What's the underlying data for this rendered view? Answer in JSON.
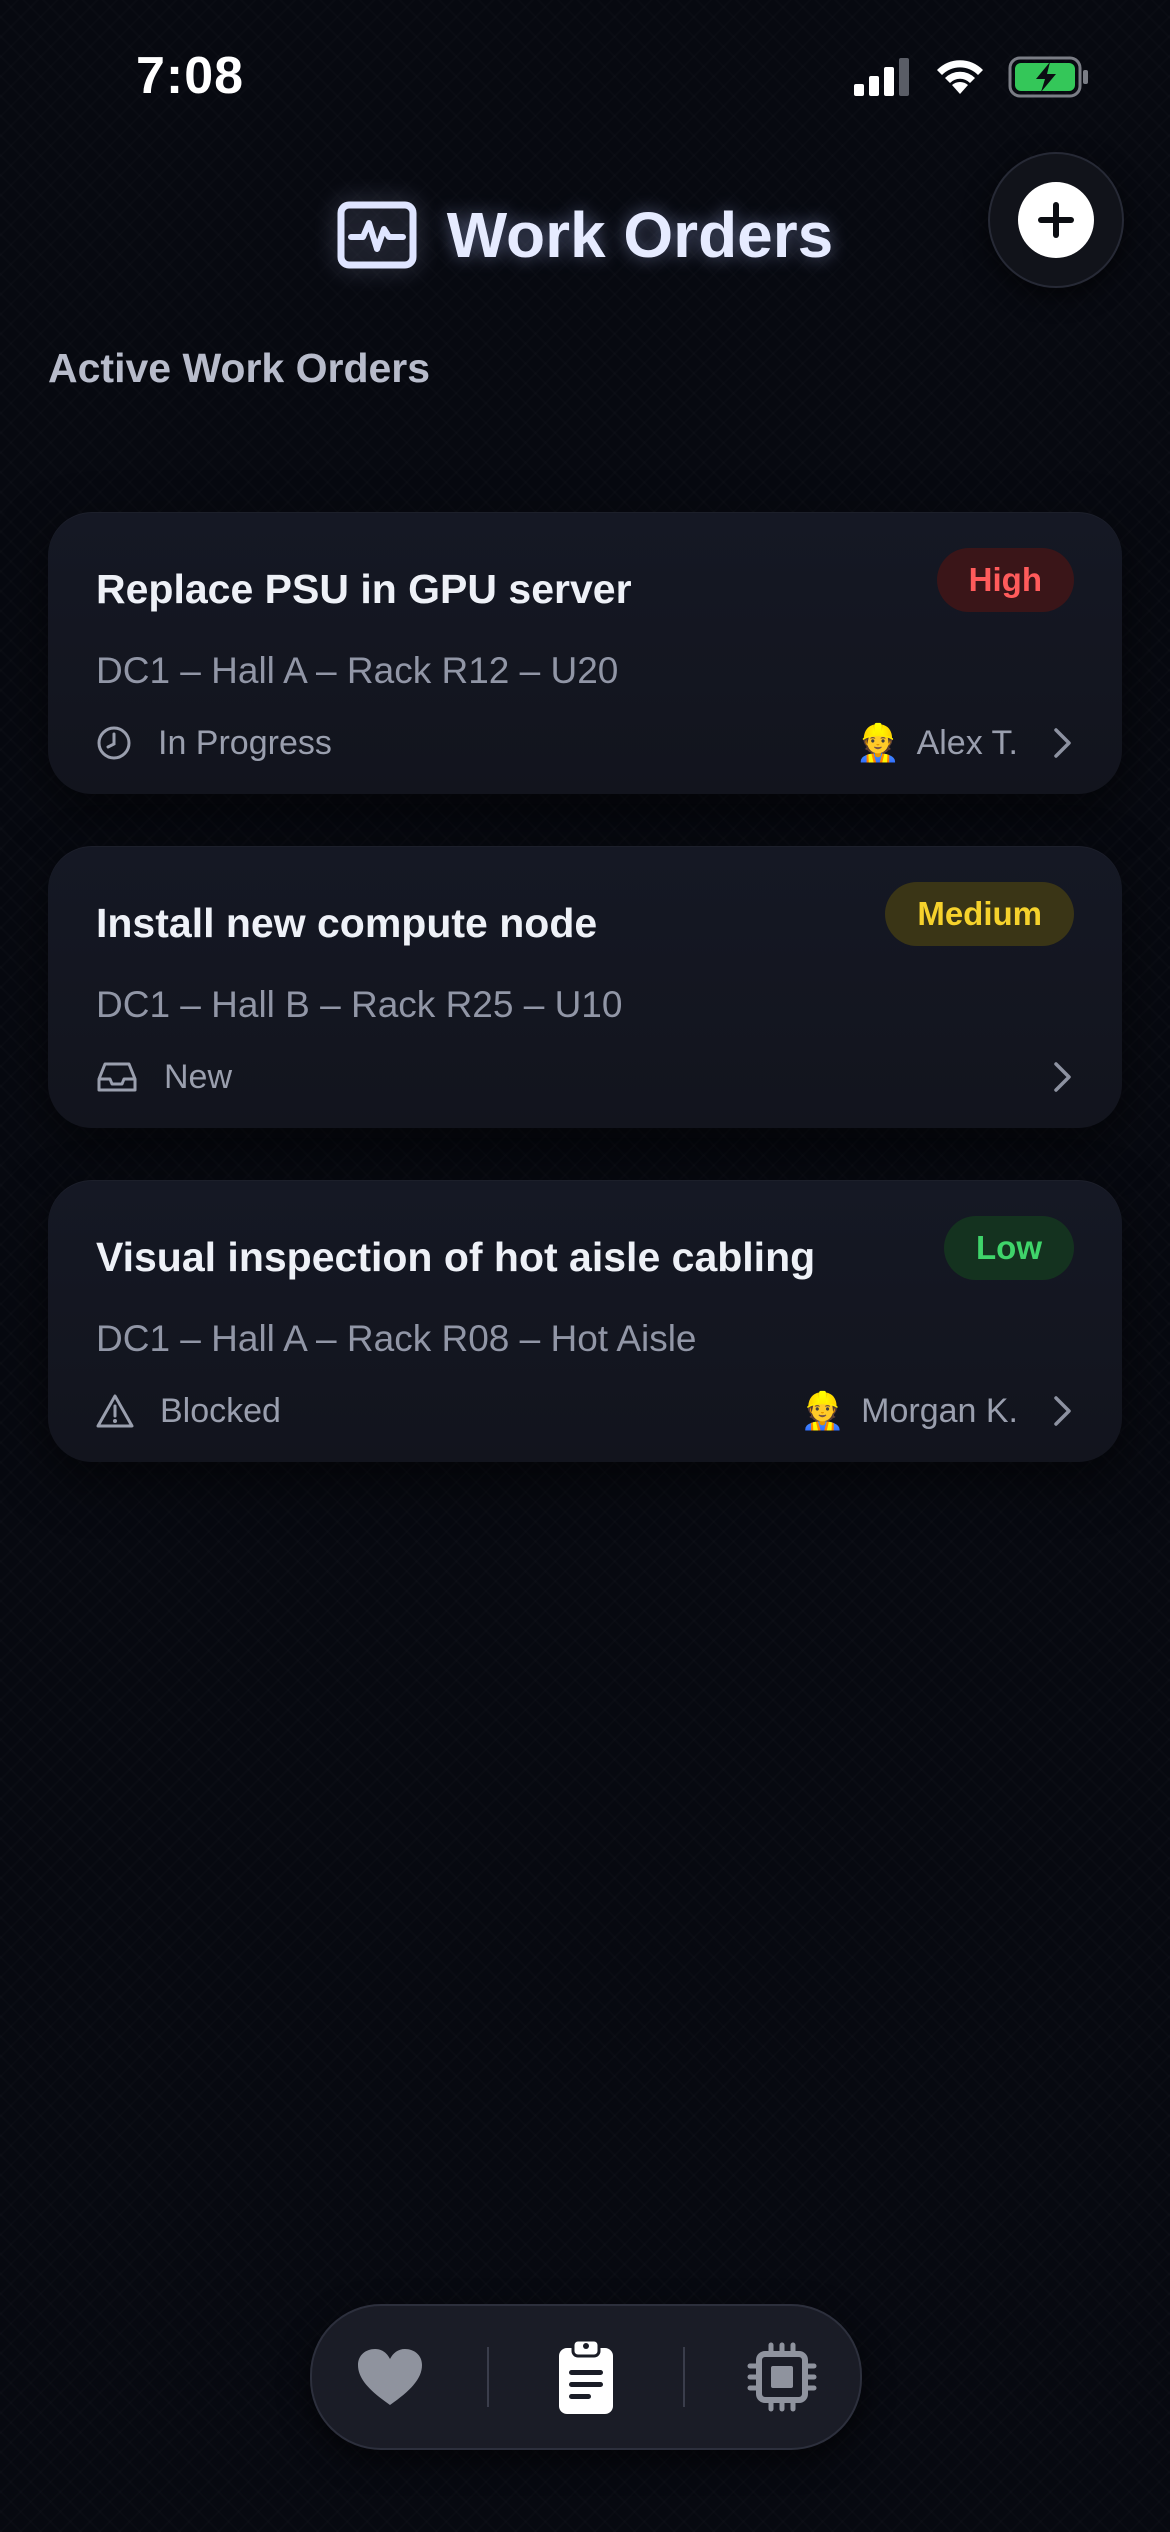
{
  "status_bar": {
    "time": "7:08",
    "icons": [
      "cellular-signal-icon",
      "wifi-icon",
      "battery-charging-icon"
    ]
  },
  "header": {
    "icon": "activity-monitor-icon",
    "title": "Work Orders",
    "add_button_icon": "plus-icon"
  },
  "section_title": "Active Work Orders",
  "work_orders": [
    {
      "title": "Replace PSU in GPU server",
      "priority": "High",
      "location": "DC1 – Hall A – Rack R12 – U20",
      "status": "In Progress",
      "status_icon": "clock-icon",
      "assignee_emoji": "👷",
      "assignee": "Alex T."
    },
    {
      "title": "Install new compute node",
      "priority": "Medium",
      "location": "DC1 – Hall B – Rack R25 – U10",
      "status": "New",
      "status_icon": "inbox-icon",
      "assignee_emoji": "",
      "assignee": ""
    },
    {
      "title": "Visual inspection of hot aisle cabling",
      "priority": "Low",
      "location": "DC1 – Hall A – Rack R08 – Hot Aisle",
      "status": "Blocked",
      "status_icon": "warning-icon",
      "assignee_emoji": "👷",
      "assignee": "Morgan K."
    }
  ],
  "tab_bar": {
    "tabs": [
      "heart-icon",
      "clipboard-icon",
      "cpu-chip-icon"
    ],
    "active": "clipboard-icon"
  },
  "colors": {
    "background": "#070910",
    "card": "#141722",
    "high": "#ff5b5b",
    "medium": "#f6d22c",
    "low": "#3fd46a"
  }
}
